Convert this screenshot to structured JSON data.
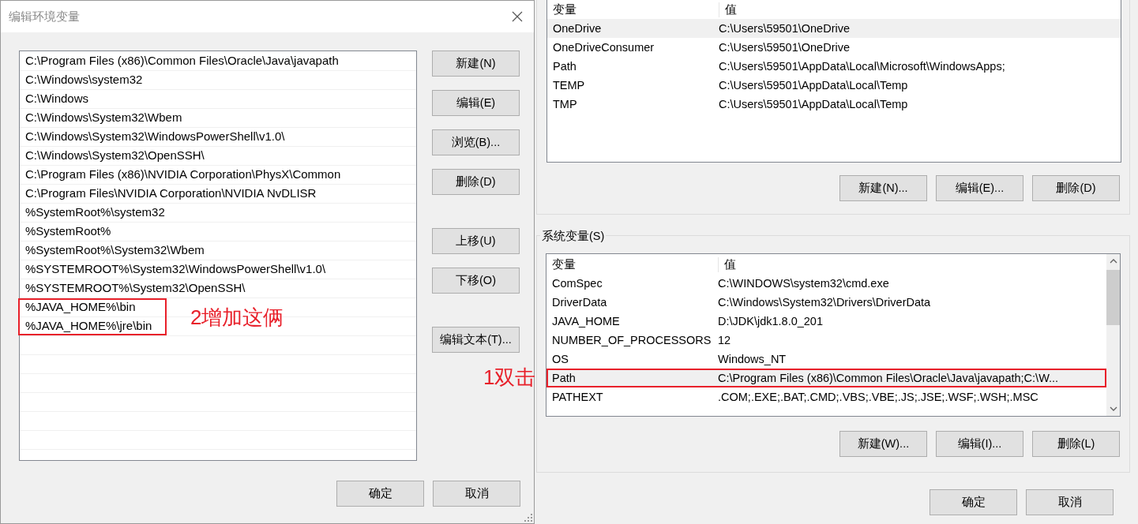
{
  "edit_dialog": {
    "title": "编辑环境变量",
    "entries": [
      {
        "text": "C:\\Program Files (x86)\\Common Files\\Oracle\\Java\\javapath",
        "annotated": false
      },
      {
        "text": "C:\\Windows\\system32",
        "annotated": false
      },
      {
        "text": "C:\\Windows",
        "annotated": false
      },
      {
        "text": "C:\\Windows\\System32\\Wbem",
        "annotated": false
      },
      {
        "text": "C:\\Windows\\System32\\WindowsPowerShell\\v1.0\\",
        "annotated": false
      },
      {
        "text": "C:\\Windows\\System32\\OpenSSH\\",
        "annotated": false
      },
      {
        "text": "C:\\Program Files (x86)\\NVIDIA Corporation\\PhysX\\Common",
        "annotated": false
      },
      {
        "text": "C:\\Program Files\\NVIDIA Corporation\\NVIDIA NvDLISR",
        "annotated": false
      },
      {
        "text": "%SystemRoot%\\system32",
        "annotated": false
      },
      {
        "text": "%SystemRoot%",
        "annotated": false
      },
      {
        "text": "%SystemRoot%\\System32\\Wbem",
        "annotated": false
      },
      {
        "text": "%SYSTEMROOT%\\System32\\WindowsPowerShell\\v1.0\\",
        "annotated": false
      },
      {
        "text": "%SYSTEMROOT%\\System32\\OpenSSH\\",
        "annotated": false
      },
      {
        "text": "%JAVA_HOME%\\bin",
        "annotated": true
      },
      {
        "text": "%JAVA_HOME%\\jre\\bin",
        "annotated": true
      }
    ],
    "callout": "2增加这俩",
    "button_groups": [
      [
        "新建(N)",
        "编辑(E)",
        "浏览(B)...",
        "删除(D)"
      ],
      [
        "上移(U)",
        "下移(O)"
      ],
      [
        "编辑文本(T)..."
      ]
    ],
    "action_buttons": [
      "确定",
      "取消"
    ]
  },
  "env_window": {
    "user_variables": {
      "columns": [
        "变量",
        "值"
      ],
      "rows": [
        {
          "name": "OneDrive",
          "value": "C:\\Users\\59501\\OneDrive",
          "selected": true
        },
        {
          "name": "OneDriveConsumer",
          "value": "C:\\Users\\59501\\OneDrive",
          "selected": false
        },
        {
          "name": "Path",
          "value": "C:\\Users\\59501\\AppData\\Local\\Microsoft\\WindowsApps;",
          "selected": false
        },
        {
          "name": "TEMP",
          "value": "C:\\Users\\59501\\AppData\\Local\\Temp",
          "selected": false
        },
        {
          "name": "TMP",
          "value": "C:\\Users\\59501\\AppData\\Local\\Temp",
          "selected": false
        }
      ],
      "buttons": [
        "新建(N)...",
        "编辑(E)...",
        "删除(D)"
      ]
    },
    "system_variables": {
      "title": "系统变量(S)",
      "columns": [
        "变量",
        "值"
      ],
      "rows": [
        {
          "name": "ComSpec",
          "value": "C:\\WINDOWS\\system32\\cmd.exe",
          "selected": false,
          "annotated": false
        },
        {
          "name": "DriverData",
          "value": "C:\\Windows\\System32\\Drivers\\DriverData",
          "selected": false,
          "annotated": false
        },
        {
          "name": "JAVA_HOME",
          "value": "D:\\JDK\\jdk1.8.0_201",
          "selected": false,
          "annotated": false
        },
        {
          "name": "NUMBER_OF_PROCESSORS",
          "value": "12",
          "selected": false,
          "annotated": false
        },
        {
          "name": "OS",
          "value": "Windows_NT",
          "selected": false,
          "annotated": false
        },
        {
          "name": "Path",
          "value": "C:\\Program Files (x86)\\Common Files\\Oracle\\Java\\javapath;C:\\W...",
          "selected": true,
          "annotated": true
        },
        {
          "name": "PATHEXT",
          "value": ".COM;.EXE;.BAT;.CMD;.VBS;.VBE;.JS;.JSE;.WSF;.WSH;.MSC",
          "selected": false,
          "annotated": false
        }
      ],
      "callout": "1双击",
      "buttons": [
        "新建(W)...",
        "编辑(I)...",
        "删除(L)"
      ]
    },
    "action_buttons": [
      "确定",
      "取消"
    ]
  }
}
